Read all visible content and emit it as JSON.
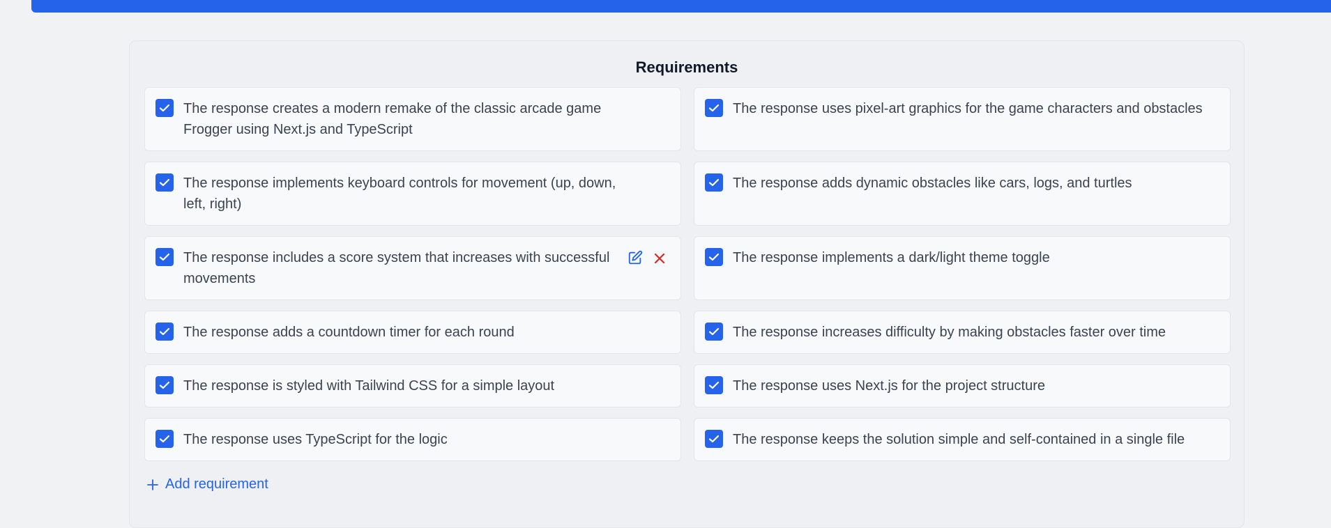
{
  "panel": {
    "title": "Requirements",
    "add_label": "Add requirement"
  },
  "colors": {
    "accent": "#2563eb",
    "delete": "#dc2626"
  },
  "requirements": [
    {
      "label": "The response creates a modern remake of the classic arcade game Frogger using Next.js and TypeScript",
      "checked": true
    },
    {
      "label": "The response uses pixel-art graphics for the game characters and obstacles",
      "checked": true
    },
    {
      "label": "The response implements keyboard controls for movement (up, down, left, right)",
      "checked": true
    },
    {
      "label": "The response adds dynamic obstacles like cars, logs, and turtles",
      "checked": true
    },
    {
      "label": "The response includes a score system that increases with successful movements",
      "checked": true
    },
    {
      "label": "The response implements a dark/light theme toggle",
      "checked": true
    },
    {
      "label": "The response adds a countdown timer for each round",
      "checked": true
    },
    {
      "label": "The response increases difficulty by making obstacles faster over time",
      "checked": true
    },
    {
      "label": "The response is styled with Tailwind CSS for a simple layout",
      "checked": true
    },
    {
      "label": "The response uses Next.js for the project structure",
      "checked": true
    },
    {
      "label": "The response uses TypeScript for the logic",
      "checked": true
    },
    {
      "label": "The response keeps the solution simple and self-contained in a single file",
      "checked": true
    }
  ]
}
